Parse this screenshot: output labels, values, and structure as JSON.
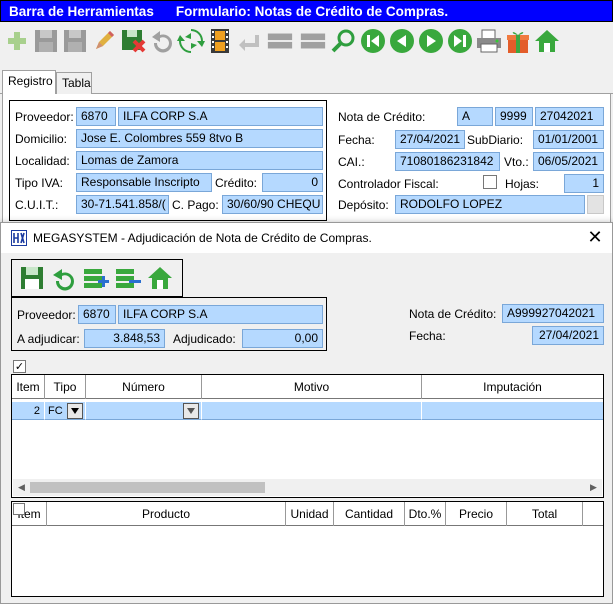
{
  "titlebar": {
    "left": "Barra de Herramientas",
    "right": "Formulario: Notas de Crédito de Compras."
  },
  "tabs": [
    {
      "label": "Registro"
    },
    {
      "label": "Tabla"
    }
  ],
  "form": {
    "proveedor_label": "Proveedor:",
    "proveedor_code": "6870",
    "proveedor_name": "ILFA CORP S.A",
    "domicilio_label": "Domicilio:",
    "domicilio": "Jose E. Colombres 559 8tvo B",
    "localidad_label": "Localidad:",
    "localidad": "Lomas de Zamora",
    "tipo_iva_label": "Tipo IVA:",
    "tipo_iva": "Responsable Inscripto",
    "credito_label": "Crédito:",
    "credito": "0",
    "cuit_label": "C.U.I.T.:",
    "cuit": "30-71.541.858/(",
    "cpago_label": "C. Pago:",
    "cpago": "30/60/90 CHEQU",
    "nota_label": "Nota de Crédito:",
    "nota_letra": "A",
    "nota_pv": "9999",
    "nota_num": "27042021",
    "fecha_label": "Fecha:",
    "fecha": "27/04/2021",
    "subdiario_label": "SubDiario:",
    "subdiario": "01/01/2001",
    "cai_label": "CAI.:",
    "cai": "71080186231842",
    "vto_label": "Vto.:",
    "vto": "06/05/2021",
    "controlador_label": "Controlador Fiscal:",
    "hojas_label": "Hojas:",
    "hojas": "1",
    "deposito_label": "Depósito:",
    "deposito": "RODOLFO LOPEZ"
  },
  "dialog": {
    "title": "MEGASYSTEM - Adjudicación de Nota de Crédito de Compras.",
    "proveedor_label": "Proveedor:",
    "proveedor_code": "6870",
    "proveedor_name": "ILFA CORP S.A",
    "a_adjudicar_label": "A adjudicar:",
    "a_adjudicar": "3.848,53",
    "adjudicado_label": "Adjudicado:",
    "adjudicado": "0,00",
    "nota_label": "Nota de Crédito:",
    "nota": "A999927042021",
    "fecha_label": "Fecha:",
    "fecha": "27/04/2021",
    "grid1": {
      "headers": [
        "Item",
        "Tipo",
        "Número",
        "Motivo",
        "Imputación"
      ],
      "row": {
        "item": "2",
        "tipo": "FC"
      }
    },
    "grid2": {
      "headers": [
        "Item",
        "Producto",
        "Unidad",
        "Cantidad",
        "Dto.%",
        "Precio",
        "Total"
      ]
    }
  },
  "colors": {
    "titlebar": "#0000ff",
    "field": "#b5d9ff"
  }
}
